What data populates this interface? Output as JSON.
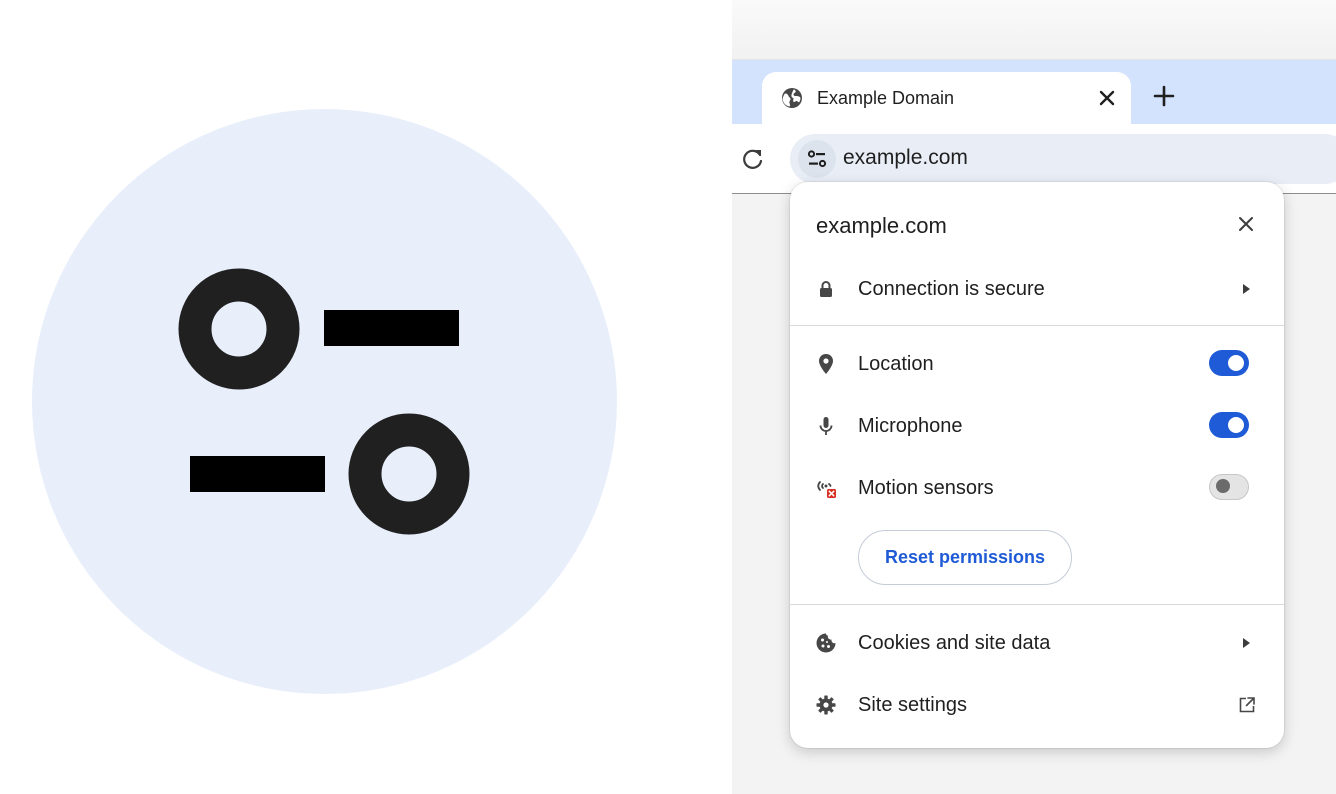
{
  "tab": {
    "title": "Example Domain",
    "icon": "globe-icon"
  },
  "omnibox": {
    "url": "example.com",
    "chip_icon": "tune-icon"
  },
  "page_info": {
    "title": "example.com",
    "connection": {
      "label": "Connection is secure",
      "icon": "lock-icon"
    },
    "permissions": [
      {
        "label": "Location",
        "icon": "location-pin-icon",
        "enabled": true
      },
      {
        "label": "Microphone",
        "icon": "microphone-icon",
        "enabled": true
      },
      {
        "label": "Motion sensors",
        "icon": "motion-sensors-blocked-icon",
        "enabled": false
      }
    ],
    "reset_button": "Reset permissions",
    "cookies": {
      "label": "Cookies and site data",
      "icon": "cookie-icon"
    },
    "site_settings": {
      "label": "Site settings",
      "icon": "gear-icon"
    }
  },
  "colors": {
    "accent": "#1f5bd6",
    "tabstrip": "#d3e3fd",
    "icon_circle": "#e8effb"
  }
}
